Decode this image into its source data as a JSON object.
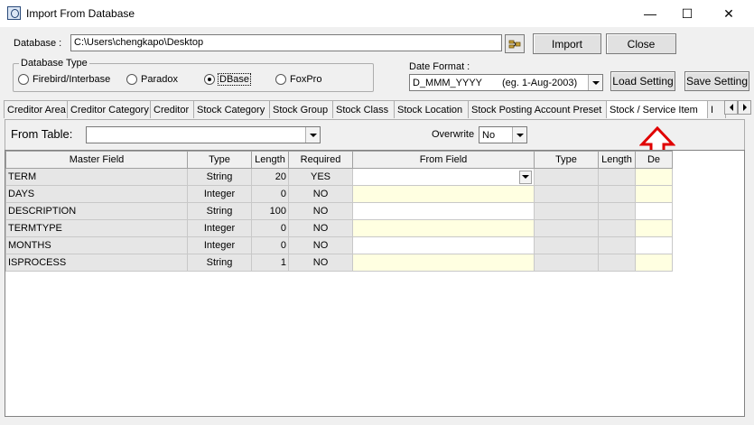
{
  "window": {
    "title": "Import From Database"
  },
  "titlebar": {
    "minimize": "—",
    "maximize": "☐",
    "close": "✕"
  },
  "database": {
    "label": "Database :",
    "path": "C:\\Users\\chengkapo\\Desktop"
  },
  "buttons": {
    "import": "Import",
    "close": "Close",
    "load_setting": "Load Setting",
    "save_setting": "Save Setting"
  },
  "database_type": {
    "title": "Database Type",
    "options": [
      "Firebird/Interbase",
      "Paradox",
      "DBase",
      "FoxPro"
    ],
    "selected": "DBase"
  },
  "date_format": {
    "label": "Date Format :",
    "value": "D_MMM_YYYY",
    "example": "(eg. 1-Aug-2003)"
  },
  "tabs": [
    "Creditor Area",
    "Creditor Category",
    "Creditor",
    "Stock Category",
    "Stock Group",
    "Stock Class",
    "Stock Location",
    "Stock Posting Account Preset",
    "Stock / Service Item",
    "I"
  ],
  "active_tab": "Stock / Service Item",
  "from_table": {
    "label": "From Table:",
    "value": ""
  },
  "overwrite": {
    "label": "Overwrite",
    "value": "No"
  },
  "grid": {
    "headers": [
      "Master Field",
      "Type",
      "Length",
      "Required",
      "From Field",
      "Type",
      "Length",
      "De"
    ],
    "rows": [
      {
        "master_field": "TERM",
        "type": "String",
        "length": "20",
        "required": "YES"
      },
      {
        "master_field": "DAYS",
        "type": "Integer",
        "length": "0",
        "required": "NO"
      },
      {
        "master_field": "DESCRIPTION",
        "type": "String",
        "length": "100",
        "required": "NO"
      },
      {
        "master_field": "TERMTYPE",
        "type": "Integer",
        "length": "0",
        "required": "NO"
      },
      {
        "master_field": "MONTHS",
        "type": "Integer",
        "length": "0",
        "required": "NO"
      },
      {
        "master_field": "ISPROCESS",
        "type": "String",
        "length": "1",
        "required": "NO"
      }
    ]
  },
  "colors": {
    "annotation_arrow": "#e00000",
    "grid_gray": "#e6e6e6",
    "grid_yellow": "#ffffe1"
  },
  "icons": {
    "app": "app-icon",
    "browse": "browse-folder-icon",
    "annotation": "red-up-arrow-icon"
  }
}
